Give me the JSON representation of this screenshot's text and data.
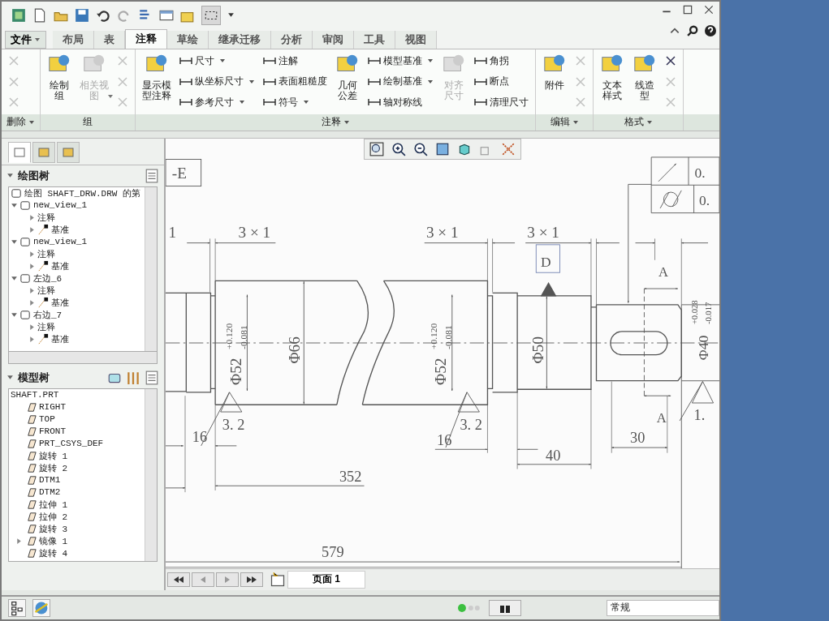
{
  "file_menu": {
    "label": "文件"
  },
  "tabs": [
    {
      "label": "布局",
      "selected": false
    },
    {
      "label": "表",
      "selected": false
    },
    {
      "label": "注释",
      "selected": true
    },
    {
      "label": "草绘",
      "selected": false
    },
    {
      "label": "继承迁移",
      "selected": false
    },
    {
      "label": "分析",
      "selected": false
    },
    {
      "label": "审阅",
      "selected": false
    },
    {
      "label": "工具",
      "selected": false
    },
    {
      "label": "视图",
      "selected": false
    }
  ],
  "ribbon": {
    "groups": [
      {
        "label": "删除",
        "menu": true,
        "columns": [
          {
            "kind": "stack",
            "items": [
              {
                "disabled": true
              },
              {
                "disabled": true
              },
              {
                "disabled": true
              }
            ]
          }
        ]
      },
      {
        "label": "组",
        "menu": false,
        "columns": [
          {
            "kind": "large",
            "items": [
              {
                "label": "绘制组",
                "disabled": false,
                "menu": false
              }
            ]
          },
          {
            "kind": "large",
            "items": [
              {
                "label": "相关视图",
                "disabled": true,
                "menu": true
              }
            ]
          },
          {
            "kind": "stack",
            "items": [
              {
                "disabled": true
              },
              {
                "disabled": true
              },
              {
                "disabled": true
              }
            ]
          }
        ]
      },
      {
        "label": "注释",
        "menu": true,
        "columns": [
          {
            "kind": "large",
            "items": [
              {
                "label": "显示模型注释",
                "disabled": false,
                "menu": false
              }
            ]
          },
          {
            "kind": "stack",
            "items": [
              {
                "label": "尺寸",
                "disabled": false,
                "menu": true
              },
              {
                "label": "纵坐标尺寸",
                "disabled": false,
                "menu": true
              },
              {
                "label": "参考尺寸",
                "disabled": false,
                "menu": true
              }
            ]
          },
          {
            "kind": "stack",
            "items": [
              {
                "label": "注解",
                "disabled": false,
                "menu": false
              },
              {
                "label": "表面粗糙度",
                "disabled": false,
                "menu": false
              },
              {
                "label": "符号",
                "disabled": false,
                "menu": true
              }
            ]
          },
          {
            "kind": "large",
            "items": [
              {
                "label": "几何公差",
                "disabled": false,
                "menu": false
              }
            ]
          },
          {
            "kind": "stack",
            "items": [
              {
                "label": "模型基准",
                "disabled": false,
                "menu": true
              },
              {
                "label": "绘制基准",
                "disabled": false,
                "menu": true
              },
              {
                "label": "轴对称线",
                "disabled": false,
                "menu": false
              }
            ]
          },
          {
            "kind": "large",
            "items": [
              {
                "label": "对齐尺寸",
                "disabled": true,
                "menu": false
              }
            ]
          },
          {
            "kind": "stack",
            "items": [
              {
                "label": "角拐",
                "disabled": false,
                "menu": false
              },
              {
                "label": "断点",
                "disabled": false,
                "menu": false
              },
              {
                "label": "清理尺寸",
                "disabled": false,
                "menu": false
              }
            ]
          }
        ]
      },
      {
        "label": "编辑",
        "menu": true,
        "columns": [
          {
            "kind": "large",
            "items": [
              {
                "label": "附件",
                "disabled": false,
                "menu": false
              }
            ]
          },
          {
            "kind": "stack",
            "items": [
              {
                "disabled": true
              },
              {
                "disabled": true
              },
              {
                "disabled": true
              }
            ]
          }
        ]
      },
      {
        "label": "格式",
        "menu": true,
        "columns": [
          {
            "kind": "large",
            "items": [
              {
                "label": "文本样式",
                "disabled": false,
                "menu": false
              }
            ]
          },
          {
            "kind": "large",
            "items": [
              {
                "label": "线造型",
                "disabled": false,
                "menu": false
              }
            ]
          },
          {
            "kind": "stack",
            "items": [
              {
                "disabled": false
              },
              {
                "disabled": true
              },
              {
                "disabled": true
              }
            ]
          }
        ]
      }
    ]
  },
  "panel_tabs": [
    {
      "selected": true
    },
    {
      "selected": false
    },
    {
      "selected": false
    }
  ],
  "drawing_tree": {
    "title": "绘图树",
    "items": [
      {
        "label": "绘图 SHAFT_DRW.DRW 的第"
      },
      {
        "label": "new_view_1",
        "expanded": true,
        "children": [
          {
            "label": "注释",
            "expanded": false
          },
          {
            "label": "基准",
            "expanded": false
          }
        ]
      },
      {
        "label": "new_view_1",
        "expanded": true,
        "children": [
          {
            "label": "注释",
            "expanded": false
          },
          {
            "label": "基准",
            "expanded": false
          }
        ]
      },
      {
        "label": "左边_6",
        "expanded": true,
        "children": [
          {
            "label": "注释",
            "expanded": false
          },
          {
            "label": "基准",
            "expanded": false
          }
        ]
      },
      {
        "label": "右边_7",
        "expanded": true,
        "children": [
          {
            "label": "注释",
            "expanded": false
          },
          {
            "label": "基准",
            "expanded": false
          }
        ]
      }
    ]
  },
  "model_tree": {
    "title": "模型树",
    "root": "SHAFT.PRT",
    "items": [
      {
        "label": "RIGHT"
      },
      {
        "label": "TOP"
      },
      {
        "label": "FRONT"
      },
      {
        "label": "PRT_CSYS_DEF"
      },
      {
        "label": "旋转 1"
      },
      {
        "label": "旋转 2"
      },
      {
        "label": "DTM1"
      },
      {
        "label": "DTM2"
      },
      {
        "label": "拉伸 1"
      },
      {
        "label": "拉伸 2"
      },
      {
        "label": "旋转 3"
      },
      {
        "label": "镜像 1",
        "expanded": false
      },
      {
        "label": "旋转 4"
      }
    ]
  },
  "drawing": {
    "labels": [
      "-E",
      "0.",
      "0.",
      "1",
      "3 × 1",
      "3 × 1",
      "3 × 1",
      "D",
      "A",
      "A",
      "Φ52",
      "+0.120",
      "-0.081",
      "Φ66",
      "Φ52",
      "+0.120",
      "-0.081",
      "Φ50",
      "Φ40",
      "+0.028",
      "-0.017",
      "3. 2",
      "16",
      "3. 2",
      "16",
      "1.",
      "40",
      "30",
      "352",
      "579"
    ]
  },
  "page_bar": {
    "page_tab": "页面 1"
  },
  "status_bar": {
    "filter": "常规"
  }
}
